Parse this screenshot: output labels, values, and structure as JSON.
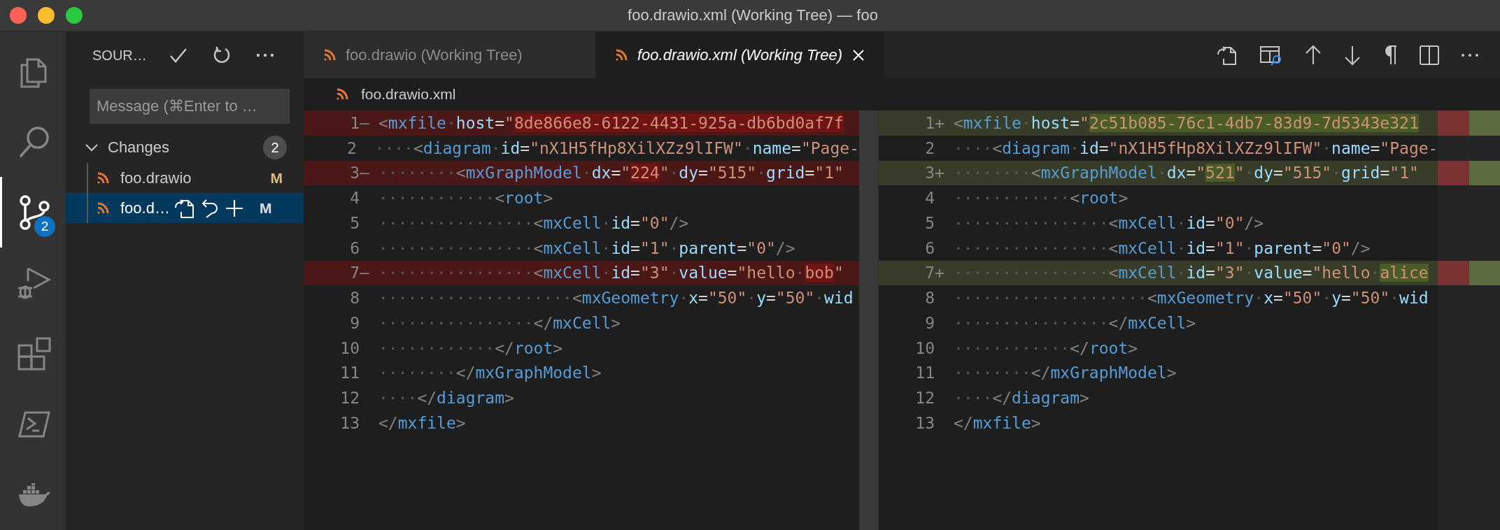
{
  "window": {
    "title": "foo.drawio.xml (Working Tree) — foo"
  },
  "activity_bar": [
    {
      "kind": "explorer",
      "selected": false
    },
    {
      "kind": "search",
      "selected": false
    },
    {
      "kind": "scm",
      "selected": true,
      "badge": "2"
    },
    {
      "kind": "debug",
      "selected": false
    },
    {
      "kind": "extensions",
      "selected": false
    },
    {
      "kind": "terminal",
      "selected": false
    },
    {
      "kind": "docker",
      "selected": false
    }
  ],
  "sidebar": {
    "title": "SOUR…",
    "message": {
      "placeholder": "Message (⌘Enter to …"
    },
    "group": {
      "label": "Changes",
      "count": "2",
      "expanded": true
    },
    "files": [
      {
        "name": "foo.drawio",
        "status": "M",
        "selected": false
      },
      {
        "name": "foo.d…",
        "status": "M",
        "selected": true
      }
    ]
  },
  "tabs": [
    {
      "label": "foo.drawio (Working Tree)",
      "selected": false
    },
    {
      "label": "foo.drawio.xml (Working Tree)",
      "selected": true
    }
  ],
  "breadcrumb": "foo.drawio.xml",
  "panes": [
    {
      "lines": [
        {
          "number": "1",
          "marker": "—",
          "kind": "removed",
          "tokens": [
            {
              "kind": "punct",
              "text": "<"
            },
            {
              "kind": "tag",
              "text": "mxfile"
            },
            {
              "kind": "space",
              "text": "·"
            },
            {
              "kind": "attr",
              "text": "host"
            },
            {
              "kind": "equals",
              "text": "="
            },
            {
              "kind": "string",
              "text": "\""
            },
            {
              "kind": "string-changed",
              "text": "8de866e8-6122-4431-925a-db6bd0af7f"
            }
          ]
        },
        {
          "number": "2",
          "kind": "plain",
          "tokens": [
            {
              "kind": "space",
              "text": "····"
            },
            {
              "kind": "punct",
              "text": "<"
            },
            {
              "kind": "tag",
              "text": "diagram"
            },
            {
              "kind": "space",
              "text": "·"
            },
            {
              "kind": "attr",
              "text": "id"
            },
            {
              "kind": "equals",
              "text": "="
            },
            {
              "kind": "string",
              "text": "\"nX1H5fHp8XilXZz9lIFW\""
            },
            {
              "kind": "space",
              "text": "·"
            },
            {
              "kind": "attr",
              "text": "name"
            },
            {
              "kind": "equals",
              "text": "="
            },
            {
              "kind": "string",
              "text": "\"Page-"
            }
          ]
        },
        {
          "number": "3",
          "marker": "—",
          "kind": "removed",
          "tokens": [
            {
              "kind": "space",
              "text": "········"
            },
            {
              "kind": "punct",
              "text": "<"
            },
            {
              "kind": "tag",
              "text": "mxGraphModel"
            },
            {
              "kind": "space",
              "text": "·"
            },
            {
              "kind": "attr",
              "text": "dx"
            },
            {
              "kind": "equals",
              "text": "="
            },
            {
              "kind": "string",
              "text": "\""
            },
            {
              "kind": "string-changed",
              "text": "224"
            },
            {
              "kind": "string",
              "text": "\""
            },
            {
              "kind": "space",
              "text": "·"
            },
            {
              "kind": "attr",
              "text": "dy"
            },
            {
              "kind": "equals",
              "text": "="
            },
            {
              "kind": "string",
              "text": "\"515\""
            },
            {
              "kind": "space",
              "text": "·"
            },
            {
              "kind": "attr",
              "text": "grid"
            },
            {
              "kind": "equals",
              "text": "="
            },
            {
              "kind": "string",
              "text": "\"1\""
            }
          ]
        },
        {
          "number": "4",
          "kind": "plain",
          "tokens": [
            {
              "kind": "space",
              "text": "············"
            },
            {
              "kind": "punct",
              "text": "<"
            },
            {
              "kind": "tag",
              "text": "root"
            },
            {
              "kind": "punct",
              "text": ">"
            }
          ]
        },
        {
          "number": "5",
          "kind": "plain",
          "tokens": [
            {
              "kind": "space",
              "text": "················"
            },
            {
              "kind": "punct",
              "text": "<"
            },
            {
              "kind": "tag",
              "text": "mxCell"
            },
            {
              "kind": "space",
              "text": "·"
            },
            {
              "kind": "attr",
              "text": "id"
            },
            {
              "kind": "equals",
              "text": "="
            },
            {
              "kind": "string",
              "text": "\"0\""
            },
            {
              "kind": "punct",
              "text": "/>"
            }
          ]
        },
        {
          "number": "6",
          "kind": "plain",
          "tokens": [
            {
              "kind": "space",
              "text": "················"
            },
            {
              "kind": "punct",
              "text": "<"
            },
            {
              "kind": "tag",
              "text": "mxCell"
            },
            {
              "kind": "space",
              "text": "·"
            },
            {
              "kind": "attr",
              "text": "id"
            },
            {
              "kind": "equals",
              "text": "="
            },
            {
              "kind": "string",
              "text": "\"1\""
            },
            {
              "kind": "space",
              "text": "·"
            },
            {
              "kind": "attr",
              "text": "parent"
            },
            {
              "kind": "equals",
              "text": "="
            },
            {
              "kind": "string",
              "text": "\"0\""
            },
            {
              "kind": "punct",
              "text": "/>"
            }
          ]
        },
        {
          "number": "7",
          "marker": "—",
          "kind": "removed",
          "tokens": [
            {
              "kind": "space",
              "text": "················"
            },
            {
              "kind": "punct",
              "text": "<"
            },
            {
              "kind": "tag",
              "text": "mxCell"
            },
            {
              "kind": "space",
              "text": "·"
            },
            {
              "kind": "attr",
              "text": "id"
            },
            {
              "kind": "equals",
              "text": "="
            },
            {
              "kind": "string",
              "text": "\"3\""
            },
            {
              "kind": "space",
              "text": "·"
            },
            {
              "kind": "attr",
              "text": "value"
            },
            {
              "kind": "equals",
              "text": "="
            },
            {
              "kind": "string",
              "text": "\"hello"
            },
            {
              "kind": "space",
              "text": "·"
            },
            {
              "kind": "string-changed",
              "text": "bob"
            },
            {
              "kind": "string",
              "text": "\""
            }
          ]
        },
        {
          "number": "8",
          "kind": "plain",
          "tokens": [
            {
              "kind": "space",
              "text": "····················"
            },
            {
              "kind": "punct",
              "text": "<"
            },
            {
              "kind": "tag",
              "text": "mxGeometry"
            },
            {
              "kind": "space",
              "text": "·"
            },
            {
              "kind": "attr",
              "text": "x"
            },
            {
              "kind": "equals",
              "text": "="
            },
            {
              "kind": "string",
              "text": "\"50\""
            },
            {
              "kind": "space",
              "text": "·"
            },
            {
              "kind": "attr",
              "text": "y"
            },
            {
              "kind": "equals",
              "text": "="
            },
            {
              "kind": "string",
              "text": "\"50\""
            },
            {
              "kind": "space",
              "text": "·"
            },
            {
              "kind": "attr",
              "text": "wid"
            }
          ]
        },
        {
          "number": "9",
          "kind": "plain",
          "tokens": [
            {
              "kind": "space",
              "text": "················"
            },
            {
              "kind": "punct",
              "text": "</"
            },
            {
              "kind": "tag",
              "text": "mxCell"
            },
            {
              "kind": "punct",
              "text": ">"
            }
          ]
        },
        {
          "number": "10",
          "kind": "plain",
          "tokens": [
            {
              "kind": "space",
              "text": "············"
            },
            {
              "kind": "punct",
              "text": "</"
            },
            {
              "kind": "tag",
              "text": "root"
            },
            {
              "kind": "punct",
              "text": ">"
            }
          ]
        },
        {
          "number": "11",
          "kind": "plain",
          "tokens": [
            {
              "kind": "space",
              "text": "········"
            },
            {
              "kind": "punct",
              "text": "</"
            },
            {
              "kind": "tag",
              "text": "mxGraphModel"
            },
            {
              "kind": "punct",
              "text": ">"
            }
          ]
        },
        {
          "number": "12",
          "kind": "plain",
          "tokens": [
            {
              "kind": "space",
              "text": "····"
            },
            {
              "kind": "punct",
              "text": "</"
            },
            {
              "kind": "tag",
              "text": "diagram"
            },
            {
              "kind": "punct",
              "text": ">"
            }
          ]
        },
        {
          "number": "13",
          "kind": "plain",
          "tokens": [
            {
              "kind": "punct",
              "text": "</"
            },
            {
              "kind": "tag",
              "text": "mxfile"
            },
            {
              "kind": "punct",
              "text": ">"
            }
          ]
        }
      ]
    },
    {
      "lines": [
        {
          "number": "1",
          "marker": "+",
          "kind": "added",
          "tokens": [
            {
              "kind": "punct",
              "text": "<"
            },
            {
              "kind": "tag",
              "text": "mxfile"
            },
            {
              "kind": "space",
              "text": "·"
            },
            {
              "kind": "attr",
              "text": "host"
            },
            {
              "kind": "equals",
              "text": "="
            },
            {
              "kind": "string",
              "text": "\""
            },
            {
              "kind": "string-changed",
              "text": "2c51b085-76c1-4db7-83d9-7d5343e321"
            }
          ]
        },
        {
          "number": "2",
          "kind": "plain",
          "tokens": [
            {
              "kind": "space",
              "text": "····"
            },
            {
              "kind": "punct",
              "text": "<"
            },
            {
              "kind": "tag",
              "text": "diagram"
            },
            {
              "kind": "space",
              "text": "·"
            },
            {
              "kind": "attr",
              "text": "id"
            },
            {
              "kind": "equals",
              "text": "="
            },
            {
              "kind": "string",
              "text": "\"nX1H5fHp8XilXZz9lIFW\""
            },
            {
              "kind": "space",
              "text": "·"
            },
            {
              "kind": "attr",
              "text": "name"
            },
            {
              "kind": "equals",
              "text": "="
            },
            {
              "kind": "string",
              "text": "\"Page-"
            }
          ]
        },
        {
          "number": "3",
          "marker": "+",
          "kind": "added",
          "tokens": [
            {
              "kind": "space",
              "text": "········"
            },
            {
              "kind": "punct",
              "text": "<"
            },
            {
              "kind": "tag",
              "text": "mxGraphModel"
            },
            {
              "kind": "space",
              "text": "·"
            },
            {
              "kind": "attr",
              "text": "dx"
            },
            {
              "kind": "equals",
              "text": "="
            },
            {
              "kind": "string",
              "text": "\""
            },
            {
              "kind": "string-changed",
              "text": "521"
            },
            {
              "kind": "string",
              "text": "\""
            },
            {
              "kind": "space",
              "text": "·"
            },
            {
              "kind": "attr",
              "text": "dy"
            },
            {
              "kind": "equals",
              "text": "="
            },
            {
              "kind": "string",
              "text": "\"515\""
            },
            {
              "kind": "space",
              "text": "·"
            },
            {
              "kind": "attr",
              "text": "grid"
            },
            {
              "kind": "equals",
              "text": "="
            },
            {
              "kind": "string",
              "text": "\"1\""
            }
          ]
        },
        {
          "number": "4",
          "kind": "plain",
          "tokens": [
            {
              "kind": "space",
              "text": "············"
            },
            {
              "kind": "punct",
              "text": "<"
            },
            {
              "kind": "tag",
              "text": "root"
            },
            {
              "kind": "punct",
              "text": ">"
            }
          ]
        },
        {
          "number": "5",
          "kind": "plain",
          "tokens": [
            {
              "kind": "space",
              "text": "················"
            },
            {
              "kind": "punct",
              "text": "<"
            },
            {
              "kind": "tag",
              "text": "mxCell"
            },
            {
              "kind": "space",
              "text": "·"
            },
            {
              "kind": "attr",
              "text": "id"
            },
            {
              "kind": "equals",
              "text": "="
            },
            {
              "kind": "string",
              "text": "\"0\""
            },
            {
              "kind": "punct",
              "text": "/>"
            }
          ]
        },
        {
          "number": "6",
          "kind": "plain",
          "tokens": [
            {
              "kind": "space",
              "text": "················"
            },
            {
              "kind": "punct",
              "text": "<"
            },
            {
              "kind": "tag",
              "text": "mxCell"
            },
            {
              "kind": "space",
              "text": "·"
            },
            {
              "kind": "attr",
              "text": "id"
            },
            {
              "kind": "equals",
              "text": "="
            },
            {
              "kind": "string",
              "text": "\"1\""
            },
            {
              "kind": "space",
              "text": "·"
            },
            {
              "kind": "attr",
              "text": "parent"
            },
            {
              "kind": "equals",
              "text": "="
            },
            {
              "kind": "string",
              "text": "\"0\""
            },
            {
              "kind": "punct",
              "text": "/>"
            }
          ]
        },
        {
          "number": "7",
          "marker": "+",
          "kind": "added",
          "tokens": [
            {
              "kind": "space",
              "text": "················"
            },
            {
              "kind": "punct",
              "text": "<"
            },
            {
              "kind": "tag",
              "text": "mxCell"
            },
            {
              "kind": "space",
              "text": "·"
            },
            {
              "kind": "attr",
              "text": "id"
            },
            {
              "kind": "equals",
              "text": "="
            },
            {
              "kind": "string",
              "text": "\"3\""
            },
            {
              "kind": "space",
              "text": "·"
            },
            {
              "kind": "attr",
              "text": "value"
            },
            {
              "kind": "equals",
              "text": "="
            },
            {
              "kind": "string",
              "text": "\"hello"
            },
            {
              "kind": "space",
              "text": "·"
            },
            {
              "kind": "string-changed",
              "text": "alice"
            }
          ]
        },
        {
          "number": "8",
          "kind": "plain",
          "tokens": [
            {
              "kind": "space",
              "text": "····················"
            },
            {
              "kind": "punct",
              "text": "<"
            },
            {
              "kind": "tag",
              "text": "mxGeometry"
            },
            {
              "kind": "space",
              "text": "·"
            },
            {
              "kind": "attr",
              "text": "x"
            },
            {
              "kind": "equals",
              "text": "="
            },
            {
              "kind": "string",
              "text": "\"50\""
            },
            {
              "kind": "space",
              "text": "·"
            },
            {
              "kind": "attr",
              "text": "y"
            },
            {
              "kind": "equals",
              "text": "="
            },
            {
              "kind": "string",
              "text": "\"50\""
            },
            {
              "kind": "space",
              "text": "·"
            },
            {
              "kind": "attr",
              "text": "wid"
            }
          ]
        },
        {
          "number": "9",
          "kind": "plain",
          "tokens": [
            {
              "kind": "space",
              "text": "················"
            },
            {
              "kind": "punct",
              "text": "</"
            },
            {
              "kind": "tag",
              "text": "mxCell"
            },
            {
              "kind": "punct",
              "text": ">"
            }
          ]
        },
        {
          "number": "10",
          "kind": "plain",
          "tokens": [
            {
              "kind": "space",
              "text": "············"
            },
            {
              "kind": "punct",
              "text": "</"
            },
            {
              "kind": "tag",
              "text": "root"
            },
            {
              "kind": "punct",
              "text": ">"
            }
          ]
        },
        {
          "number": "11",
          "kind": "plain",
          "tokens": [
            {
              "kind": "space",
              "text": "········"
            },
            {
              "kind": "punct",
              "text": "</"
            },
            {
              "kind": "tag",
              "text": "mxGraphModel"
            },
            {
              "kind": "punct",
              "text": ">"
            }
          ]
        },
        {
          "number": "12",
          "kind": "plain",
          "tokens": [
            {
              "kind": "space",
              "text": "····"
            },
            {
              "kind": "punct",
              "text": "</"
            },
            {
              "kind": "tag",
              "text": "diagram"
            },
            {
              "kind": "punct",
              "text": ">"
            }
          ]
        },
        {
          "number": "13",
          "kind": "plain",
          "tokens": [
            {
              "kind": "punct",
              "text": "</"
            },
            {
              "kind": "tag",
              "text": "mxfile"
            },
            {
              "kind": "punct",
              "text": ">"
            }
          ]
        }
      ]
    }
  ]
}
